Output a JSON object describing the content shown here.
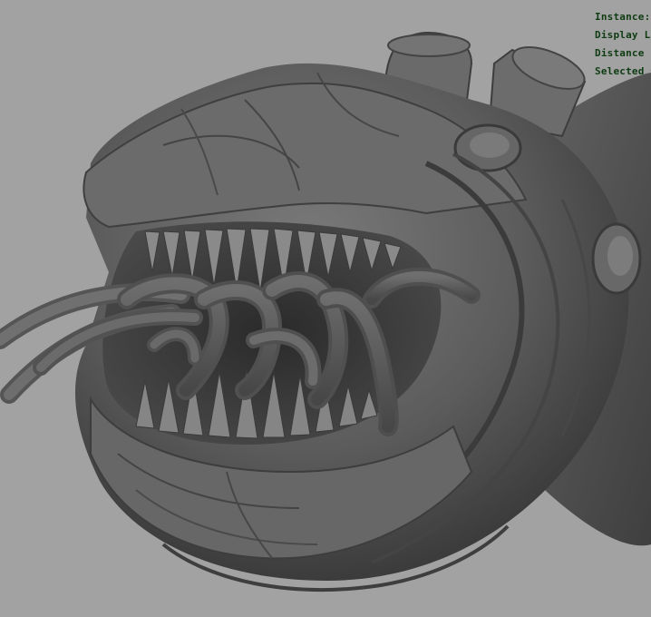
{
  "viewport": {
    "background_color": "#a2a2a2",
    "model_color": "#5f5f5f",
    "hud_color": "#0e3b12"
  },
  "hud": {
    "lines": [
      "Instance:",
      "Display Laye",
      "Distance Fr",
      "Selected O"
    ]
  }
}
